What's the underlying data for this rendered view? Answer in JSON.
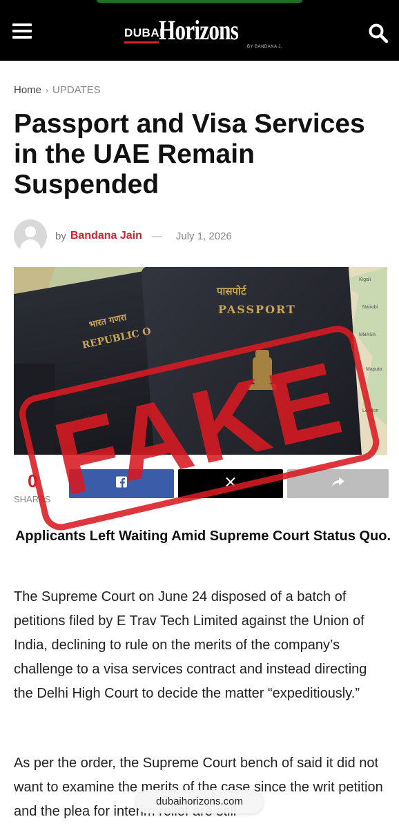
{
  "header": {
    "logo_prefix": "DUBAI",
    "logo_main": "Horizons",
    "logo_tagline": "BY BANDANA J.",
    "menu_icon": "hamburger-icon",
    "search_icon": "search-icon"
  },
  "breadcrumb": {
    "home": "Home",
    "separator": "›",
    "category": "UPDATES"
  },
  "article": {
    "title": "Passport and Visa Services in the UAE Remain Suspended",
    "byline_prefix": "by",
    "author": "Bandana Jain",
    "dash": "—",
    "date": "July 1, 2026",
    "hero": {
      "passport_word": "PASSPORT",
      "passport_word_hindi": "पासपोर्ट",
      "republic_text": "REPUBLIC O",
      "republic_hindi": "भारत गणरा",
      "stamp_text": "FAKE"
    },
    "subtitle": "Applicants Left Waiting Amid Supreme Court Status Quo.",
    "paragraphs": [
      "The Supreme Court on June 24 disposed of a batch of petitions filed by E Trav Tech Limited against the Union of India, declining to rule on the merits of the company’s challenge to a visa services contract and instead directing the Delhi High Court to decide the matter “expeditiously.”",
      "As per the order, the Supreme Court bench of said it did not want to examine the merits of the case since the writ petition and the plea for interim relief are still"
    ]
  },
  "share": {
    "count": "0",
    "label": "SHARES",
    "facebook_icon": "facebook-icon",
    "x_icon": "x-icon",
    "share_icon": "share-icon"
  },
  "browser": {
    "url": "dubaihorizons.com"
  },
  "colors": {
    "accent_red": "#d51f2a",
    "stamp_red": "#d81a22",
    "facebook_blue": "#3b5ca8",
    "header_black": "#000000"
  }
}
